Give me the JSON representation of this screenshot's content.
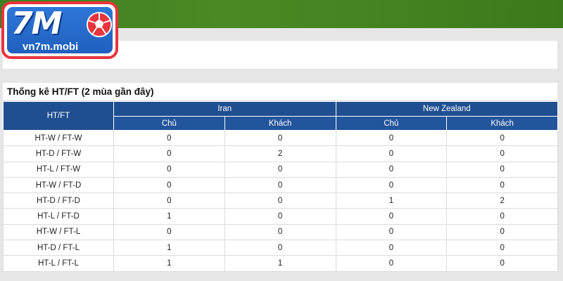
{
  "logo": {
    "mark": "7M",
    "site": "vn7m.mobi"
  },
  "panel": {
    "title": "Thống kê HT/FT (2 mùa gần đây)"
  },
  "table": {
    "first_header": "HT/FT",
    "teams": [
      "Iran",
      "New Zealand"
    ],
    "sub_headers": [
      "Chủ",
      "Khách",
      "Chủ",
      "Khách"
    ],
    "rows": [
      {
        "label": "HT-W / FT-W",
        "cells": [
          "0",
          "0",
          "0",
          "0"
        ]
      },
      {
        "label": "HT-D / FT-W",
        "cells": [
          "0",
          "2",
          "0",
          "0"
        ]
      },
      {
        "label": "HT-L / FT-W",
        "cells": [
          "0",
          "0",
          "0",
          "0"
        ]
      },
      {
        "label": "HT-W / FT-D",
        "cells": [
          "0",
          "0",
          "0",
          "0"
        ]
      },
      {
        "label": "HT-D / FT-D",
        "cells": [
          "0",
          "0",
          "1",
          "2"
        ]
      },
      {
        "label": "HT-L / FT-D",
        "cells": [
          "1",
          "0",
          "0",
          "0"
        ]
      },
      {
        "label": "HT-W / FT-L",
        "cells": [
          "0",
          "0",
          "0",
          "0"
        ]
      },
      {
        "label": "HT-D / FT-L",
        "cells": [
          "1",
          "0",
          "0",
          "0"
        ]
      },
      {
        "label": "HT-L / FT-L",
        "cells": [
          "1",
          "1",
          "0",
          "0"
        ]
      }
    ]
  },
  "colors": {
    "header_blue": "#1f4f91",
    "banner_green": "#4a8a24",
    "logo_red": "#e8343d"
  }
}
